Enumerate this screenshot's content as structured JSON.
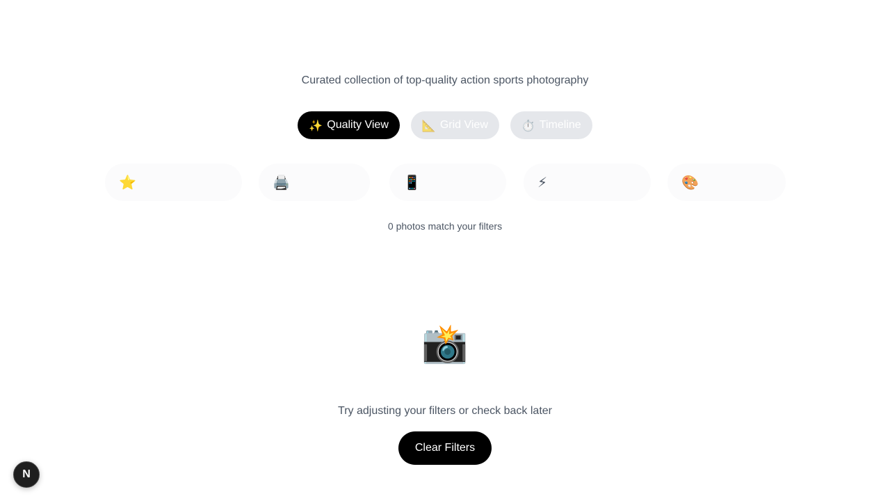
{
  "header": {
    "subtitle": "Curated collection of top-quality action sports photography"
  },
  "view_tabs": [
    {
      "icon": "✨",
      "icon_name": "sparkles-icon",
      "label": "Quality View",
      "active": true
    },
    {
      "icon": "📐",
      "icon_name": "triangular-ruler-icon",
      "label": "Grid View",
      "active": false
    },
    {
      "icon": "⏱️",
      "icon_name": "stopwatch-icon",
      "label": "Timeline",
      "active": false
    }
  ],
  "filters": [
    {
      "icon": "⭐",
      "icon_name": "star-icon"
    },
    {
      "icon": "🖨️",
      "icon_name": "printer-icon"
    },
    {
      "icon": "📱",
      "icon_name": "mobile-phone-icon"
    },
    {
      "icon": "⚡",
      "icon_name": "lightning-icon"
    },
    {
      "icon": "🎨",
      "icon_name": "palette-icon"
    }
  ],
  "results": {
    "count_text": "0 photos match your filters"
  },
  "empty_state": {
    "icon": "📸",
    "icon_name": "camera-flash-icon",
    "message": "Try adjusting your filters or check back later",
    "clear_label": "Clear Filters"
  },
  "dev_badge": {
    "label": "N",
    "icon_name": "nextjs-icon"
  },
  "colors": {
    "accent": "#000000",
    "inactive_tab": "#e5e7eb",
    "text_muted": "#4b5563"
  }
}
